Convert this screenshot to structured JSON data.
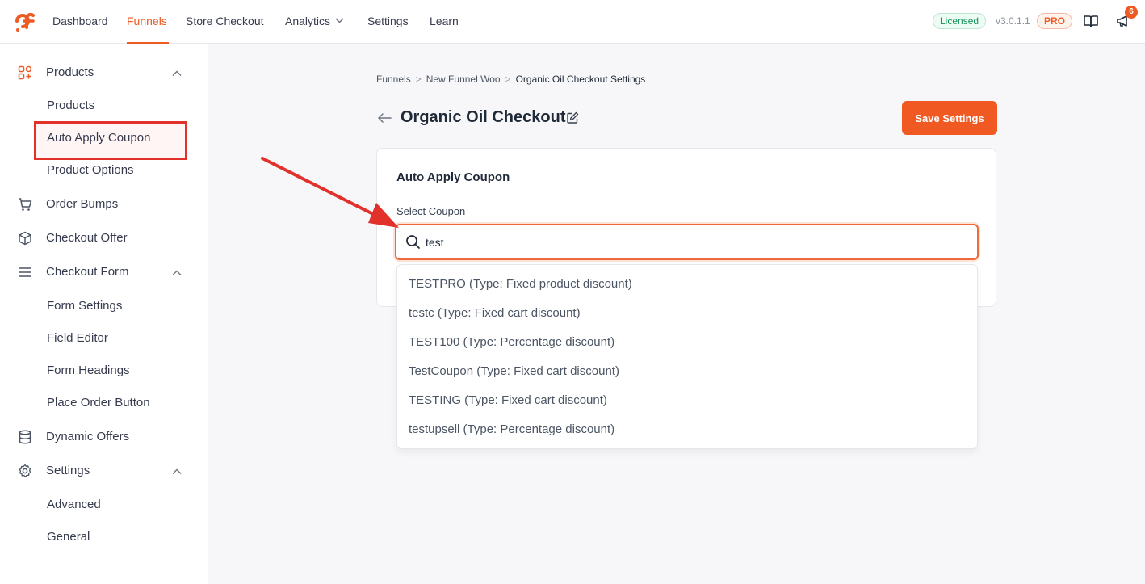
{
  "topbar": {
    "nav": [
      {
        "label": "Dashboard"
      },
      {
        "label": "Funnels"
      },
      {
        "label": "Store Checkout"
      },
      {
        "label": "Analytics"
      },
      {
        "label": "Settings"
      },
      {
        "label": "Learn"
      }
    ],
    "license_badge": "Licensed",
    "version": "v3.0.1.1",
    "pro_badge": "PRO",
    "notification_count": "6"
  },
  "sidebar": {
    "products": "Products",
    "products_sub": [
      "Products",
      "Auto Apply Coupon",
      "Product Options"
    ],
    "order_bumps": "Order Bumps",
    "checkout_offer": "Checkout Offer",
    "checkout_form": "Checkout Form",
    "checkout_form_sub": [
      "Form Settings",
      "Field Editor",
      "Form Headings",
      "Place Order Button"
    ],
    "dynamic_offers": "Dynamic Offers",
    "settings": "Settings",
    "settings_sub": [
      "Advanced",
      "General"
    ]
  },
  "breadcrumb": {
    "items": [
      "Funnels",
      "New Funnel Woo",
      "Organic Oil Checkout Settings"
    ]
  },
  "page": {
    "title": "Organic Oil Checkout",
    "save_label": "Save Settings"
  },
  "card": {
    "title": "Auto Apply Coupon",
    "field_label": "Select Coupon",
    "search_value": "test"
  },
  "dropdown": {
    "options": [
      "TESTPRO (Type: Fixed product discount)",
      "testc (Type: Fixed cart discount)",
      "TEST100 (Type: Percentage discount)",
      "TestCoupon (Type: Fixed cart discount)",
      "TESTING (Type: Fixed cart discount)",
      "testupsell (Type: Percentage discount)"
    ]
  },
  "colors": {
    "accent": "#ee5a24",
    "annotation": "#e2312b",
    "licensed": "#15935a"
  },
  "icons": [
    "brand-logo-icon",
    "chevron-down-icon",
    "book-icon",
    "megaphone-icon",
    "products-grid-icon",
    "chevron-up-icon",
    "cart-icon",
    "box-icon",
    "menu-lines-icon",
    "database-icon",
    "gear-icon",
    "arrow-left-icon",
    "edit-icon",
    "search-icon",
    "annotation-arrow-icon"
  ]
}
